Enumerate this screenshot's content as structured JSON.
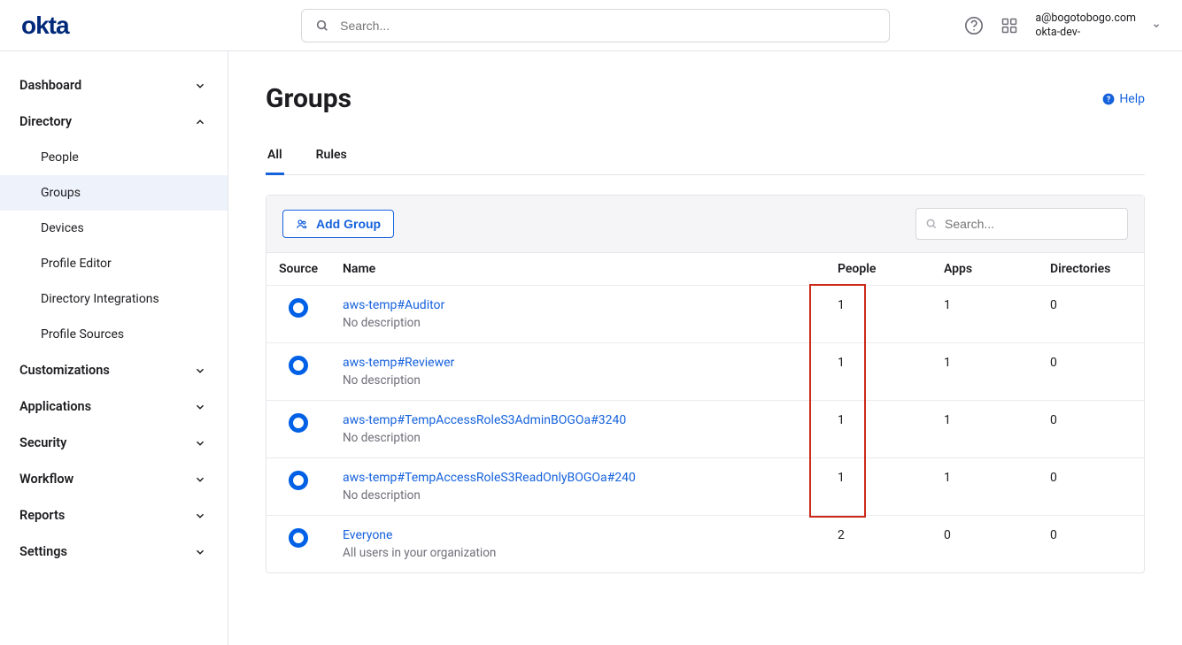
{
  "brand": "okta",
  "top_search": {
    "placeholder": "Search..."
  },
  "account": {
    "email": "a@bogotobogo.com",
    "org_prefix": "okta-dev-",
    "org_hidden": "        "
  },
  "help": {
    "label": "Help"
  },
  "sidebar": {
    "sections": [
      {
        "label": "Dashboard",
        "expanded": false
      },
      {
        "label": "Directory",
        "expanded": true,
        "items": [
          {
            "label": "People"
          },
          {
            "label": "Groups",
            "active": true
          },
          {
            "label": "Devices"
          },
          {
            "label": "Profile Editor"
          },
          {
            "label": "Directory Integrations"
          },
          {
            "label": "Profile Sources"
          }
        ]
      },
      {
        "label": "Customizations",
        "expanded": false
      },
      {
        "label": "Applications",
        "expanded": false
      },
      {
        "label": "Security",
        "expanded": false
      },
      {
        "label": "Workflow",
        "expanded": false
      },
      {
        "label": "Reports",
        "expanded": false
      },
      {
        "label": "Settings",
        "expanded": false
      }
    ]
  },
  "page": {
    "title": "Groups"
  },
  "tabs": [
    {
      "label": "All",
      "active": true
    },
    {
      "label": "Rules",
      "active": false
    }
  ],
  "toolbar": {
    "add_label": "Add Group",
    "search_placeholder": "Search..."
  },
  "columns": {
    "source": "Source",
    "name": "Name",
    "people": "People",
    "apps": "Apps",
    "directories": "Directories"
  },
  "groups": [
    {
      "name": "aws-temp#Auditor",
      "desc": "No description",
      "people": "1",
      "apps": "1",
      "directories": "0"
    },
    {
      "name": "aws-temp#Reviewer",
      "desc": "No description",
      "people": "1",
      "apps": "1",
      "directories": "0"
    },
    {
      "name_parts": [
        "aws-temp#TempAccessRoleS3AdminBOGOa#3",
        "          ",
        "240"
      ],
      "desc": "No description",
      "people": "1",
      "apps": "1",
      "directories": "0"
    },
    {
      "name_parts": [
        "aws-temp#TempAccessRoleS3ReadOnlyBOGOa#",
        "            ",
        "240"
      ],
      "desc": "No description",
      "people": "1",
      "apps": "1",
      "directories": "0"
    },
    {
      "name": "Everyone",
      "desc": "All users in your organization",
      "people": "2",
      "apps": "0",
      "directories": "0"
    }
  ]
}
